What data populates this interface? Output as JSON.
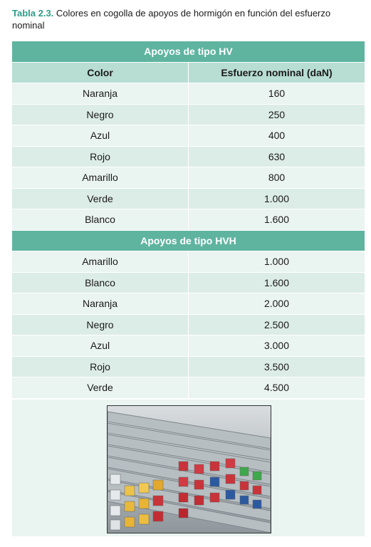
{
  "caption": {
    "label": "Tabla 2.3.",
    "text": " Colores en cogolla de apoyos de hormigón en función del esfuerzo nominal"
  },
  "table": {
    "section_hv": "Apoyos de tipo HV",
    "col_color": "Color",
    "col_esfuerzo": "Esfuerzo nominal (daN)",
    "hv_rows": [
      {
        "color": "Naranja",
        "value": "160"
      },
      {
        "color": "Negro",
        "value": "250"
      },
      {
        "color": "Azul",
        "value": "400"
      },
      {
        "color": "Rojo",
        "value": "630"
      },
      {
        "color": "Amarillo",
        "value": "800"
      },
      {
        "color": "Verde",
        "value": "1.000"
      },
      {
        "color": "Blanco",
        "value": "1.600"
      }
    ],
    "section_hvh": "Apoyos de tipo HVH",
    "hvh_rows": [
      {
        "color": "Amarillo",
        "value": "1.000"
      },
      {
        "color": "Blanco",
        "value": "1.600"
      },
      {
        "color": "Naranja",
        "value": "2.000"
      },
      {
        "color": "Negro",
        "value": "2.500"
      },
      {
        "color": "Azul",
        "value": "3.000"
      },
      {
        "color": "Rojo",
        "value": "3.500"
      },
      {
        "color": "Verde",
        "value": "4.500"
      }
    ]
  }
}
